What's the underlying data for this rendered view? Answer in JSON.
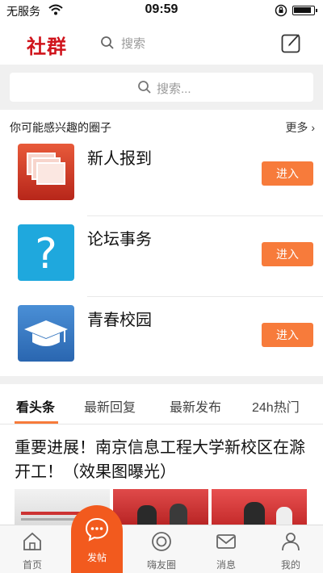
{
  "status_bar": {
    "carrier": "无服务",
    "time": "09:59"
  },
  "nav": {
    "title": "社群",
    "search_label": "搜索"
  },
  "search": {
    "placeholder": "搜索..."
  },
  "circles": {
    "header": "你可能感兴趣的圈子",
    "more": "更多",
    "items": [
      {
        "name": "新人报到",
        "button": "进入",
        "icon": "stacked-cards-icon"
      },
      {
        "name": "论坛事务",
        "button": "进入",
        "icon": "question-mark-icon"
      },
      {
        "name": "青春校园",
        "button": "进入",
        "icon": "graduation-cap-icon"
      }
    ]
  },
  "tabs": {
    "items": [
      {
        "label": "看头条"
      },
      {
        "label": "最新回复"
      },
      {
        "label": "最新发布"
      },
      {
        "label": "24h热门"
      }
    ],
    "active_index": 0
  },
  "article": {
    "title": "重要进展！南京信息工程大学新校区在滁开工！（效果图曝光）"
  },
  "tabbar": {
    "items": [
      {
        "label": "首页",
        "icon": "home-icon"
      },
      {
        "label": "发帖",
        "icon": "chat-bubble-icon"
      },
      {
        "label": "嗨友圈",
        "icon": "circle-icon"
      },
      {
        "label": "消息",
        "icon": "envelope-icon"
      },
      {
        "label": "我的",
        "icon": "user-icon"
      }
    ]
  },
  "colors": {
    "brand": "#d0141c",
    "accent": "#f77b3b",
    "fab": "#f25a1e"
  }
}
